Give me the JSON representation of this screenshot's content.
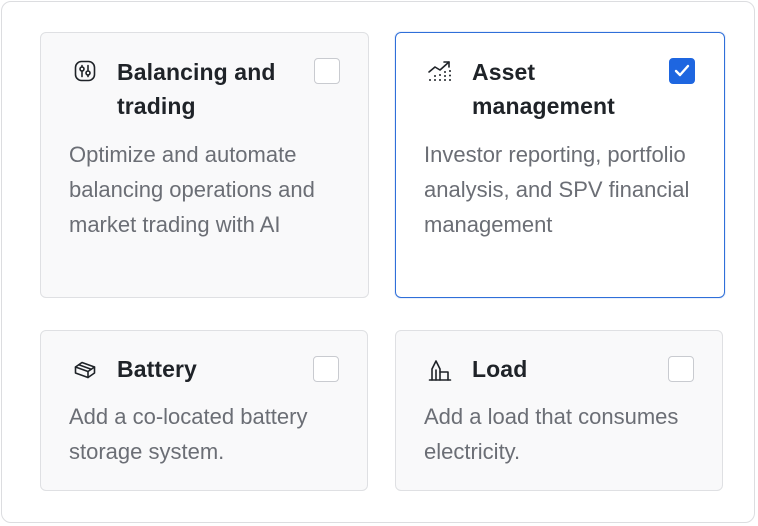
{
  "cards": [
    {
      "title": "Balancing and trading",
      "description": "Optimize and automate balancing operations and market trading with AI",
      "icon": "balance-icon",
      "checked": false
    },
    {
      "title": "Asset management",
      "description": "Investor reporting, portfolio analysis, and SPV financial management",
      "icon": "growth-chart-icon",
      "checked": true
    },
    {
      "title": "Battery",
      "description": "Add a co-located battery storage system.",
      "icon": "battery-box-icon",
      "checked": false
    },
    {
      "title": "Load",
      "description": "Add a load that consumes electricity.",
      "icon": "factory-icon",
      "checked": false
    }
  ],
  "colors": {
    "accent": "#1e66e0",
    "selected_border": "#2f6fd9",
    "card_background": "#f9f9fa",
    "description_text": "#6b6e75"
  }
}
